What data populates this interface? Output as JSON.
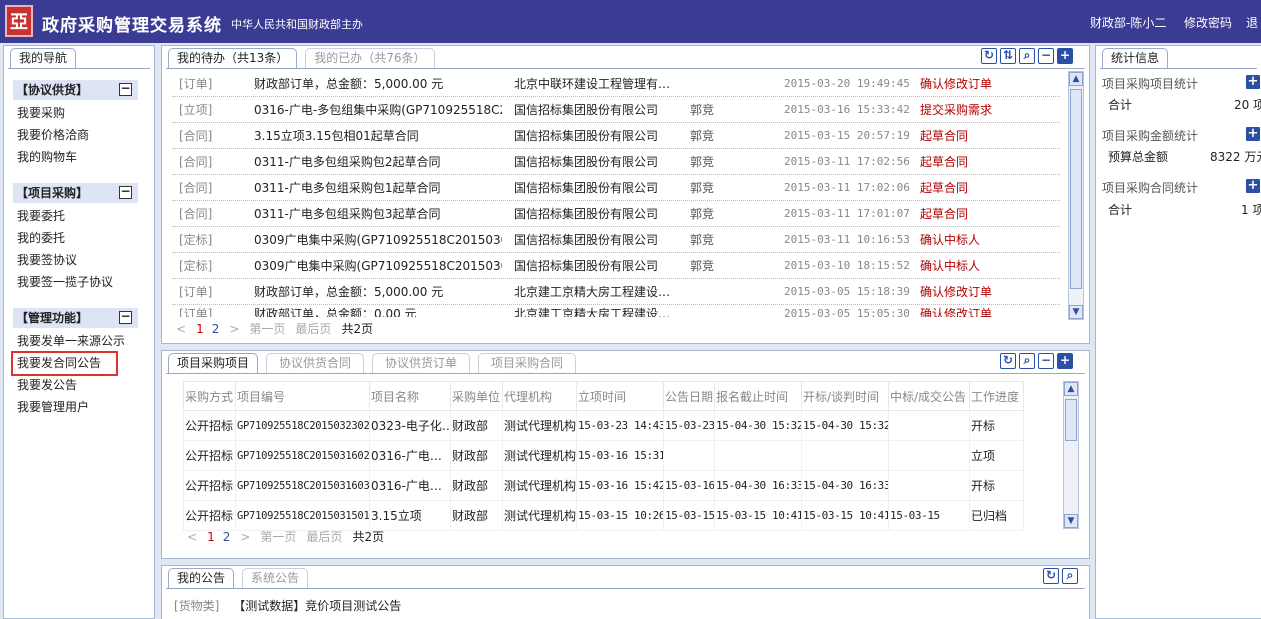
{
  "header": {
    "logo_char": "亞",
    "title": "政府采购管理交易系统",
    "subtitle": "中华人民共和国财政部主办",
    "user": "财政部-陈小二",
    "change_password": "修改密码",
    "logout": "退"
  },
  "nav": {
    "tab": "我的导航",
    "groups": [
      {
        "title": "【协议供货】",
        "items": [
          "我要采购",
          "我要价格洽商",
          "我的购物车"
        ]
      },
      {
        "title": "【项目采购】",
        "items": [
          "我要委托",
          "我的委托",
          "我要签协议",
          "我要签一揽子协议"
        ]
      },
      {
        "title": "【管理功能】",
        "items": [
          "我要发单一来源公示",
          "我要发合同公告",
          "我要发公告",
          "我要管理用户"
        ]
      }
    ],
    "highlighted": "我要发合同公告"
  },
  "todo": {
    "tab_active": "我的待办（共13条）",
    "tab_done": "我的已办（共76条）",
    "rows": [
      {
        "tag": "[订单]",
        "title": "财政部订单，总金额：5,000.00 元",
        "org": "北京中联环建设工程管理有…",
        "user": "",
        "time": "2015-03-20 19:49:45",
        "action": "确认修改订单"
      },
      {
        "tag": "[立项]",
        "title": "0316-广电-多包组集中采购(GP710925518C20…",
        "org": "国信招标集团股份有限公司",
        "user": "郭竞",
        "time": "2015-03-16 15:33:42",
        "action": "提交采购需求"
      },
      {
        "tag": "[合同]",
        "title": "3.15立项3.15包相01起草合同",
        "org": "国信招标集团股份有限公司",
        "user": "郭竞",
        "time": "2015-03-15 20:57:19",
        "action": "起草合同"
      },
      {
        "tag": "[合同]",
        "title": "0311-广电多包组采购包2起草合同",
        "org": "国信招标集团股份有限公司",
        "user": "郭竞",
        "time": "2015-03-11 17:02:56",
        "action": "起草合同"
      },
      {
        "tag": "[合同]",
        "title": "0311-广电多包组采购包1起草合同",
        "org": "国信招标集团股份有限公司",
        "user": "郭竞",
        "time": "2015-03-11 17:02:06",
        "action": "起草合同"
      },
      {
        "tag": "[合同]",
        "title": "0311-广电多包组采购包3起草合同",
        "org": "国信招标集团股份有限公司",
        "user": "郭竞",
        "time": "2015-03-11 17:01:07",
        "action": "起草合同"
      },
      {
        "tag": "[定标]",
        "title": "0309广电集中采购(GP710925518C2015030902…",
        "org": "国信招标集团股份有限公司",
        "user": "郭竞",
        "time": "2015-03-11 10:16:53",
        "action": "确认中标人"
      },
      {
        "tag": "[定标]",
        "title": "0309广电集中采购(GP710925518C2015030902…",
        "org": "国信招标集团股份有限公司",
        "user": "郭竞",
        "time": "2015-03-10 18:15:52",
        "action": "确认中标人"
      },
      {
        "tag": "[订单]",
        "title": "财政部订单，总金额：5,000.00 元",
        "org": "北京建工京精大房工程建设…",
        "user": "",
        "time": "2015-03-05 15:18:39",
        "action": "确认修改订单"
      },
      {
        "tag": "[订单]",
        "title": "财政部订单，总金额：0.00 元",
        "org": "北京建工京精大房工程建设…",
        "user": "",
        "time": "2015-03-05 15:05:30",
        "action": "确认修改订单"
      }
    ],
    "pager": {
      "prev": "<",
      "pages": [
        "1",
        "2"
      ],
      "next": ">",
      "first": "第一页",
      "last": "最后页",
      "total": "共2页"
    }
  },
  "projects": {
    "tabs": [
      "项目采购项目",
      "协议供货合同",
      "协议供货订单",
      "项目采购合同"
    ],
    "columns": [
      "采购方式",
      "项目编号",
      "项目名称",
      "采购单位",
      "代理机构",
      "立项时间",
      "公告日期",
      "报名截止时间",
      "开标/谈判时间",
      "中标/成交公告",
      "工作进度"
    ],
    "rows": [
      [
        "公开招标",
        "GP710925518C2015032302",
        "0323-电子化…",
        "财政部",
        "测试代理机构",
        "15-03-23 14:43",
        "15-03-23",
        "15-04-30 15:32",
        "15-04-30 15:32",
        "",
        "开标"
      ],
      [
        "公开招标",
        "GP710925518C2015031602",
        "0316-广电…",
        "财政部",
        "测试代理机构",
        "15-03-16 15:31",
        "",
        "",
        "",
        "",
        "立项"
      ],
      [
        "公开招标",
        "GP710925518C2015031603",
        "0316-广电…",
        "财政部",
        "测试代理机构",
        "15-03-16 15:42",
        "15-03-16",
        "15-04-30 16:33",
        "15-04-30 16:33",
        "",
        "开标"
      ],
      [
        "公开招标",
        "GP710925518C2015031501",
        "3.15立项",
        "财政部",
        "测试代理机构",
        "15-03-15 10:26",
        "15-03-15",
        "15-03-15 10:41",
        "15-03-15 10:41",
        "15-03-15",
        "已归档"
      ]
    ],
    "pager": {
      "prev": "<",
      "pages": [
        "1",
        "2"
      ],
      "next": ">",
      "first": "第一页",
      "last": "最后页",
      "total": "共2页"
    }
  },
  "notices": {
    "tab_active": "我的公告",
    "tab_system": "系统公告",
    "items": [
      {
        "tag": "[货物类]",
        "title": "【测试数据】竞价项目测试公告"
      }
    ]
  },
  "stats": {
    "tab": "统计信息",
    "groups": [
      {
        "label": "项目采购项目统计",
        "key": "合计",
        "value": "20 项"
      },
      {
        "label": "项目采购金额统计",
        "key": "预算总金额",
        "value": "8322 万元"
      },
      {
        "label": "项目采购合同统计",
        "key": "合计",
        "value": "1 项"
      }
    ]
  },
  "icons": {
    "refresh": "refresh-icon",
    "sort": "sort-icon",
    "search": "search-icon",
    "collapse": "minus-icon",
    "expand": "plus-icon"
  },
  "colors": {
    "header_bg": "#3b3b93",
    "action_red": "#b00000",
    "link_blue": "#4a8bd3",
    "highlight_box": "#e03030"
  }
}
